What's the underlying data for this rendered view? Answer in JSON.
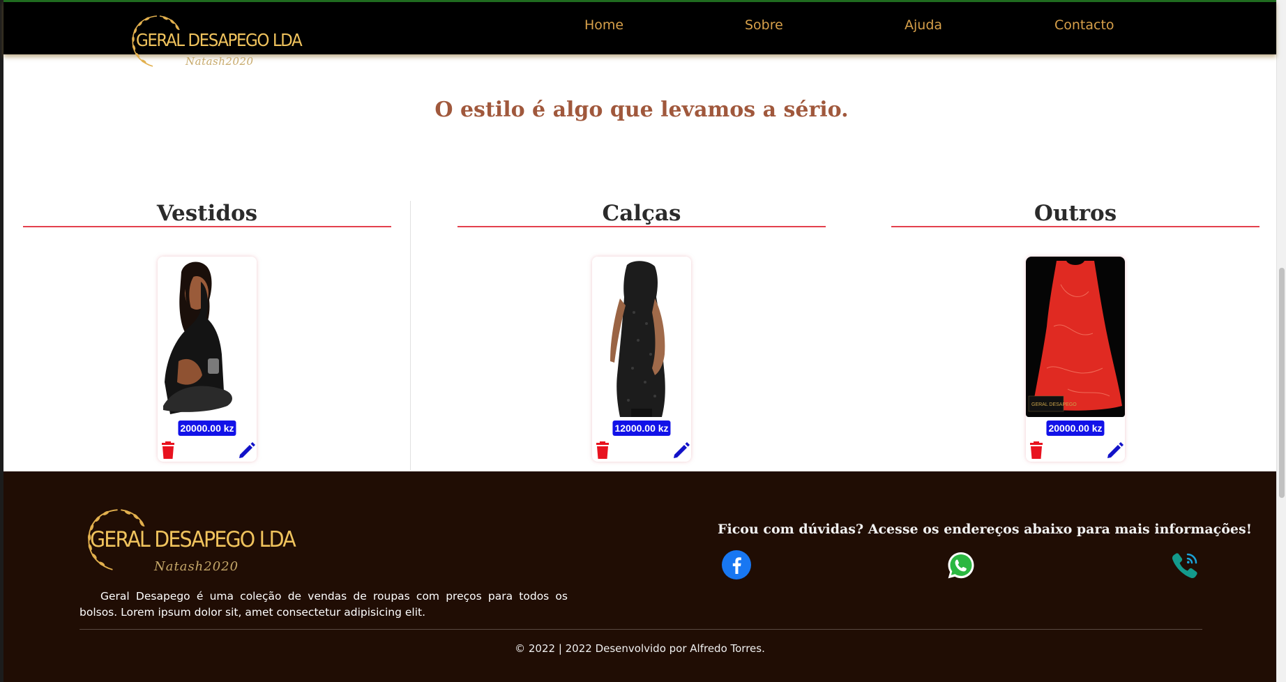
{
  "header": {
    "brand": {
      "name": "GERAL DESAPEGO LDA",
      "signature": "Natash2020"
    },
    "nav": [
      {
        "label": "Home"
      },
      {
        "label": "Sobre"
      },
      {
        "label": "Ajuda"
      },
      {
        "label": "Contacto"
      }
    ]
  },
  "main": {
    "tagline": "O estilo é algo que levamos a sério.",
    "categories": [
      {
        "title": "Vestidos",
        "products": [
          {
            "price": "20000.00 kz"
          }
        ]
      },
      {
        "title": "Calças",
        "products": [
          {
            "price": "12000.00 kz"
          }
        ]
      },
      {
        "title": "Outros",
        "products": [
          {
            "price": "20000.00 kz"
          }
        ]
      }
    ]
  },
  "footer": {
    "brand": {
      "name": "GERAL DESAPEGO LDA",
      "signature": "Natash2020"
    },
    "description": "Geral Desapego é uma coleção de vendas de roupas com preços para todos os bolsos. Lorem ipsum dolor sit, amet consectetur adipisicing elit.",
    "question": "Ficou com dúvidas? Acesse os endereços abaixo para mais informações!",
    "social": [
      {
        "icon": "facebook-icon"
      },
      {
        "icon": "whatsapp-icon"
      },
      {
        "icon": "phone-icon"
      }
    ],
    "copyright": "© 2022 | 2022 Desenvolvido por Alfredo Torres."
  },
  "colors": {
    "nav_bg": "#000000",
    "nav_link": "#d7a04a",
    "brand_gold": "#f0c35d",
    "tagline": "#a0583c",
    "category_rule": "#e3404d",
    "price_badge": "#1212e8",
    "trash": "#e8121f",
    "edit": "#1212c8",
    "footer_bg": "#200d04"
  }
}
